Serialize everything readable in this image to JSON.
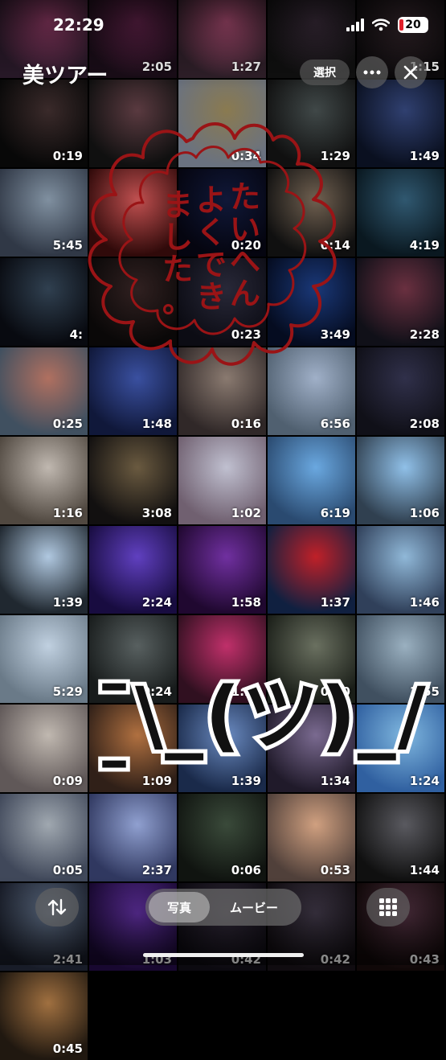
{
  "status_bar": {
    "time": "22:29",
    "battery": "20"
  },
  "header": {
    "album_title": "美ツアー",
    "select_label": "選択"
  },
  "bottom_bar": {
    "photos_label": "写真",
    "movies_label": "ムービー"
  },
  "tiles": [
    {
      "duration": "",
      "colors": [
        "#a04070",
        "#2a1a2a"
      ]
    },
    {
      "duration": "2:05",
      "colors": [
        "#6a2550",
        "#1a0d18"
      ]
    },
    {
      "duration": "1:27",
      "colors": [
        "#c05580",
        "#30202a"
      ]
    },
    {
      "duration": "",
      "colors": [
        "#403040",
        "#101010"
      ]
    },
    {
      "duration": "1:15",
      "colors": [
        "#3a2a30",
        "#0c0a0c"
      ]
    },
    {
      "duration": "0:19",
      "colors": [
        "#3a2a2a",
        "#080808"
      ]
    },
    {
      "duration": "",
      "colors": [
        "#5a3a40",
        "#101010"
      ]
    },
    {
      "duration": "0:34",
      "colors": [
        "#8a7a50",
        "#6a7280"
      ]
    },
    {
      "duration": "1:29",
      "colors": [
        "#404848",
        "#101010"
      ]
    },
    {
      "duration": "1:49",
      "colors": [
        "#304070",
        "#0a1020"
      ]
    },
    {
      "duration": "5:45",
      "colors": [
        "#8090a0",
        "#303846"
      ]
    },
    {
      "duration": "",
      "colors": [
        "#c05050",
        "#300a0a"
      ]
    },
    {
      "duration": "0:20",
      "colors": [
        "#101838",
        "#050510"
      ]
    },
    {
      "duration": "0:14",
      "colors": [
        "#706050",
        "#101010"
      ]
    },
    {
      "duration": "4:19",
      "colors": [
        "#305870",
        "#0a1820"
      ]
    },
    {
      "duration": "4:",
      "colors": [
        "#304050",
        "#080a10"
      ]
    },
    {
      "duration": "",
      "colors": [
        "#302020",
        "#0a0808"
      ]
    },
    {
      "duration": "0:23",
      "colors": [
        "#282838",
        "#0c0c14"
      ]
    },
    {
      "duration": "3:49",
      "colors": [
        "#1a3878",
        "#050c20"
      ]
    },
    {
      "duration": "2:28",
      "colors": [
        "#6a3040",
        "#101018"
      ]
    },
    {
      "duration": "0:25",
      "colors": [
        "#b07060",
        "#405060"
      ]
    },
    {
      "duration": "1:48",
      "colors": [
        "#3a50a0",
        "#10183a"
      ]
    },
    {
      "duration": "0:16",
      "colors": [
        "#8a7a70",
        "#302828"
      ]
    },
    {
      "duration": "6:56",
      "colors": [
        "#a0b0c8",
        "#506070"
      ]
    },
    {
      "duration": "2:08",
      "colors": [
        "#30304a",
        "#101018"
      ]
    },
    {
      "duration": "1:16",
      "colors": [
        "#c0b8b0",
        "#504840"
      ]
    },
    {
      "duration": "3:08",
      "colors": [
        "#6a5a40",
        "#121010"
      ]
    },
    {
      "duration": "1:02",
      "colors": [
        "#c0c0d0",
        "#706070"
      ]
    },
    {
      "duration": "6:19",
      "colors": [
        "#6aa8e0",
        "#2a4a70"
      ]
    },
    {
      "duration": "1:06",
      "colors": [
        "#90c0e8",
        "#304050"
      ]
    },
    {
      "duration": "1:39",
      "colors": [
        "#b0c8e0",
        "#202830"
      ]
    },
    {
      "duration": "2:24",
      "colors": [
        "#6040c0",
        "#180c40"
      ]
    },
    {
      "duration": "1:58",
      "colors": [
        "#7030a0",
        "#200830"
      ]
    },
    {
      "duration": "1:37",
      "colors": [
        "#c02028",
        "#102040"
      ]
    },
    {
      "duration": "1:46",
      "colors": [
        "#90b8d8",
        "#30405a"
      ]
    },
    {
      "duration": "5:29",
      "colors": [
        "#c0d0e0",
        "#6a7a88"
      ]
    },
    {
      "duration": "0:24",
      "colors": [
        "#586060",
        "#181c1c"
      ]
    },
    {
      "duration": "1:29",
      "colors": [
        "#c0306a",
        "#301020"
      ]
    },
    {
      "duration": "0:30",
      "colors": [
        "#6a7060",
        "#1a1e18"
      ]
    },
    {
      "duration": "1:55",
      "colors": [
        "#9ab0c0",
        "#405060"
      ]
    },
    {
      "duration": "0:09",
      "colors": [
        "#c0b8b0",
        "#605858"
      ]
    },
    {
      "duration": "1:09",
      "colors": [
        "#b07040",
        "#302018"
      ]
    },
    {
      "duration": "1:39",
      "colors": [
        "#6a8ac0",
        "#1a2a4a"
      ]
    },
    {
      "duration": "1:34",
      "colors": [
        "#7a6a90",
        "#201a2a"
      ]
    },
    {
      "duration": "1:24",
      "colors": [
        "#80b8e0",
        "#3060a0"
      ]
    },
    {
      "duration": "0:05",
      "colors": [
        "#a0a8b0",
        "#40485a"
      ]
    },
    {
      "duration": "2:37",
      "colors": [
        "#90a0d0",
        "#303860"
      ]
    },
    {
      "duration": "0:06",
      "colors": [
        "#3a4a3a",
        "#101410"
      ]
    },
    {
      "duration": "0:53",
      "colors": [
        "#d0a080",
        "#50403a"
      ]
    },
    {
      "duration": "1:44",
      "colors": [
        "#5a5a60",
        "#101010"
      ]
    },
    {
      "duration": "2:41",
      "colors": [
        "#607088",
        "#181c28"
      ]
    },
    {
      "duration": "1:03",
      "colors": [
        "#6030a0",
        "#180830"
      ]
    },
    {
      "duration": "0:42",
      "colors": [
        "#302838",
        "#0c0a10"
      ]
    },
    {
      "duration": "0:42",
      "colors": [
        "#403848",
        "#100c10"
      ]
    },
    {
      "duration": "0:43",
      "colors": [
        "#503040",
        "#100808"
      ]
    },
    {
      "duration": "0:45",
      "colors": [
        "#a07040",
        "#201810"
      ]
    }
  ],
  "stamp_text": "たいへんよくできました。",
  "shrug_text": "¯\\_(ツ)_/¯",
  "colors": {
    "stamp_red": "#9a1416",
    "battery_red": "#e0202a"
  }
}
